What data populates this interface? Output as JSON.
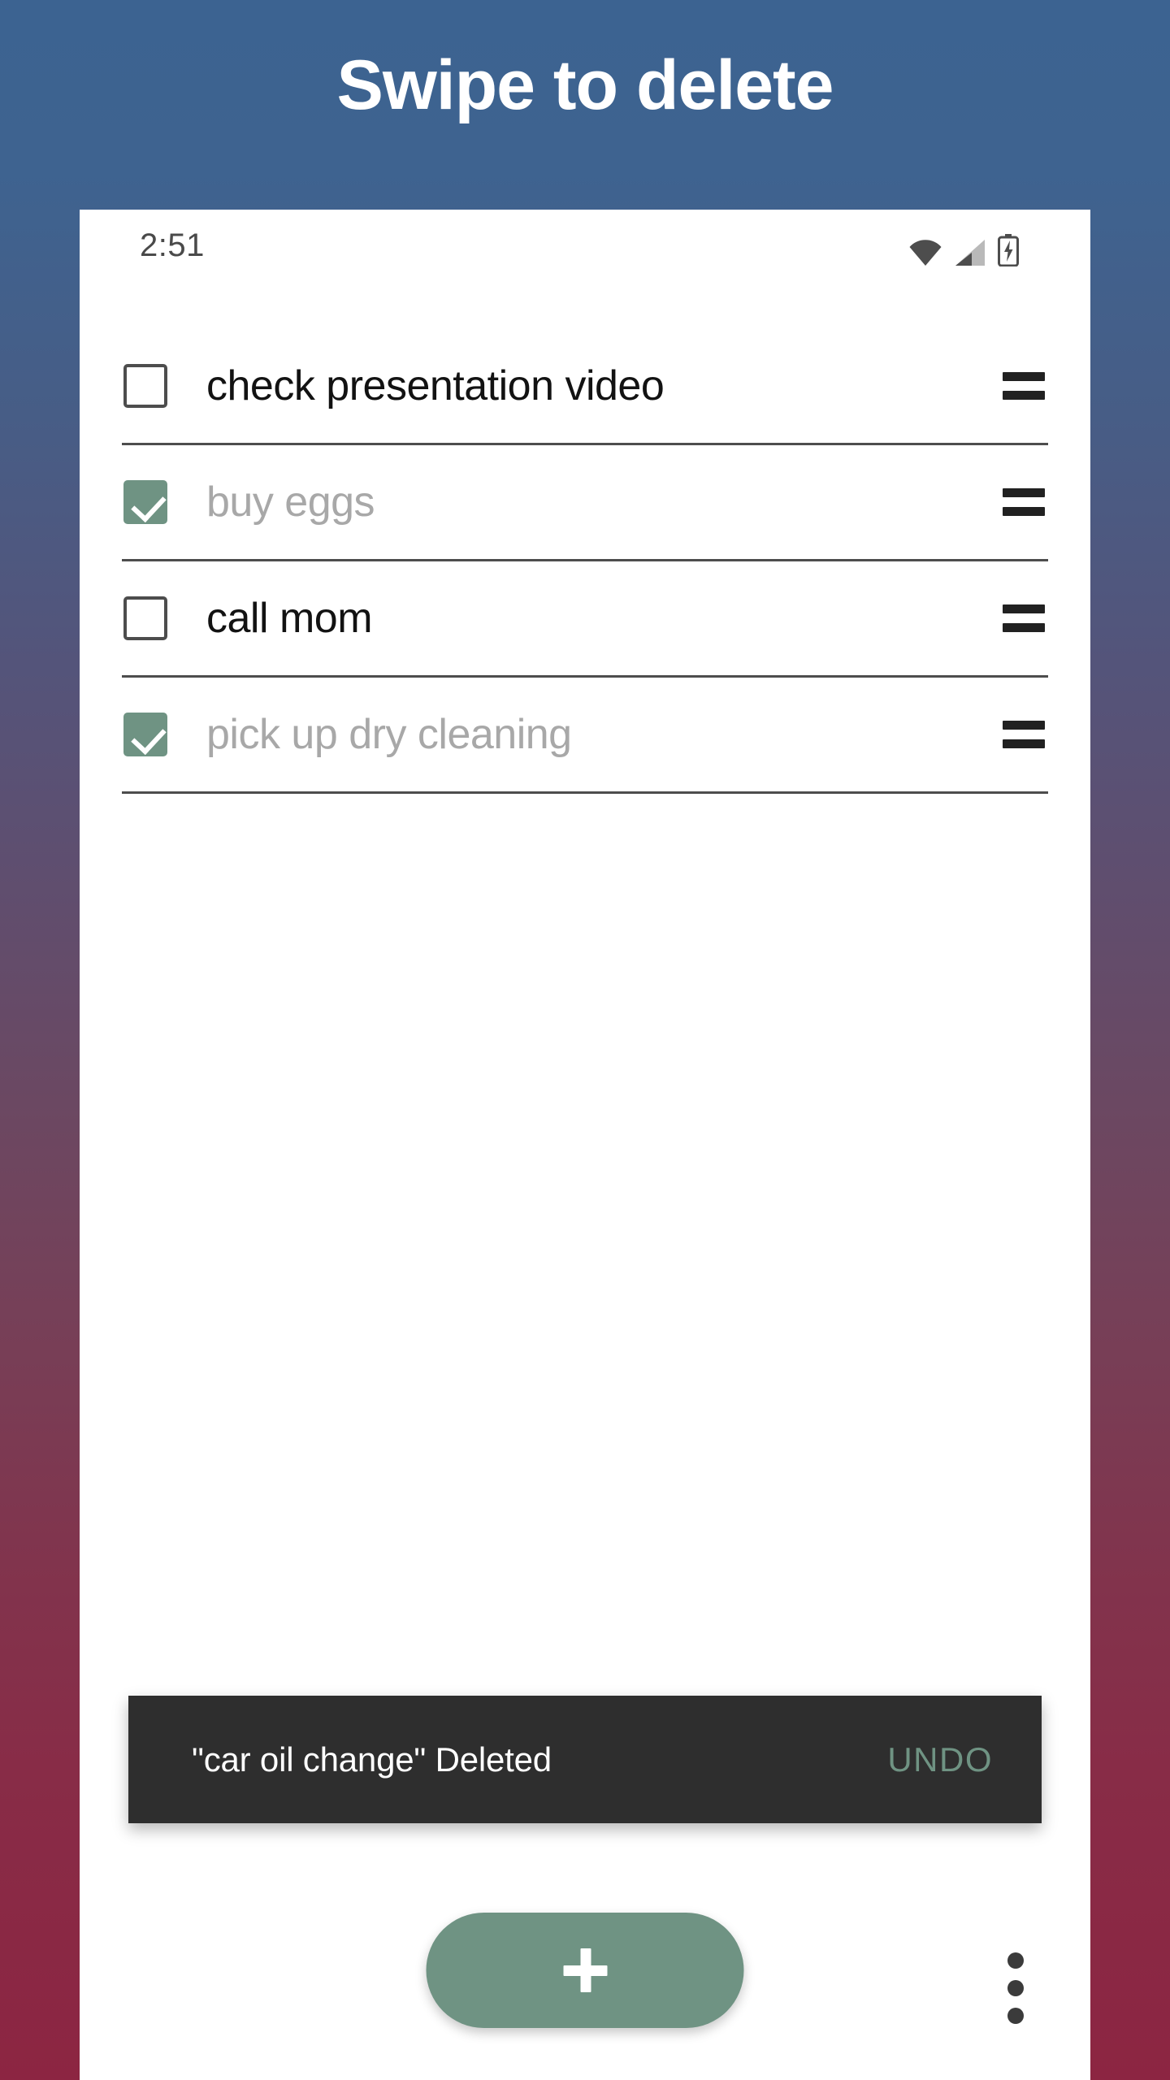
{
  "page": {
    "title": "Swipe to delete"
  },
  "status_bar": {
    "time": "2:51",
    "icons": [
      "wifi-icon",
      "cellular-signal-icon",
      "battery-charging-icon"
    ]
  },
  "tasks": [
    {
      "label": "check presentation video",
      "checked": false,
      "handle": "drag-handle-icon"
    },
    {
      "label": "buy eggs",
      "checked": true,
      "handle": "drag-handle-icon"
    },
    {
      "label": "call mom",
      "checked": false,
      "handle": "drag-handle-icon"
    },
    {
      "label": "pick up dry cleaning",
      "checked": true,
      "handle": "drag-handle-icon"
    }
  ],
  "snackbar": {
    "message": "\"car oil change\" Deleted",
    "action": "UNDO"
  },
  "bottom_bar": {
    "fab_icon": "plus-icon",
    "overflow_icon": "more-vertical-icon"
  },
  "colors": {
    "accent_green": "#6f9383",
    "snackbar_bg": "#2e2e2e",
    "bg_top": "#3c6391",
    "bg_bottom": "#8c2542",
    "text_primary": "#121212",
    "text_done": "#a8a8a8"
  }
}
